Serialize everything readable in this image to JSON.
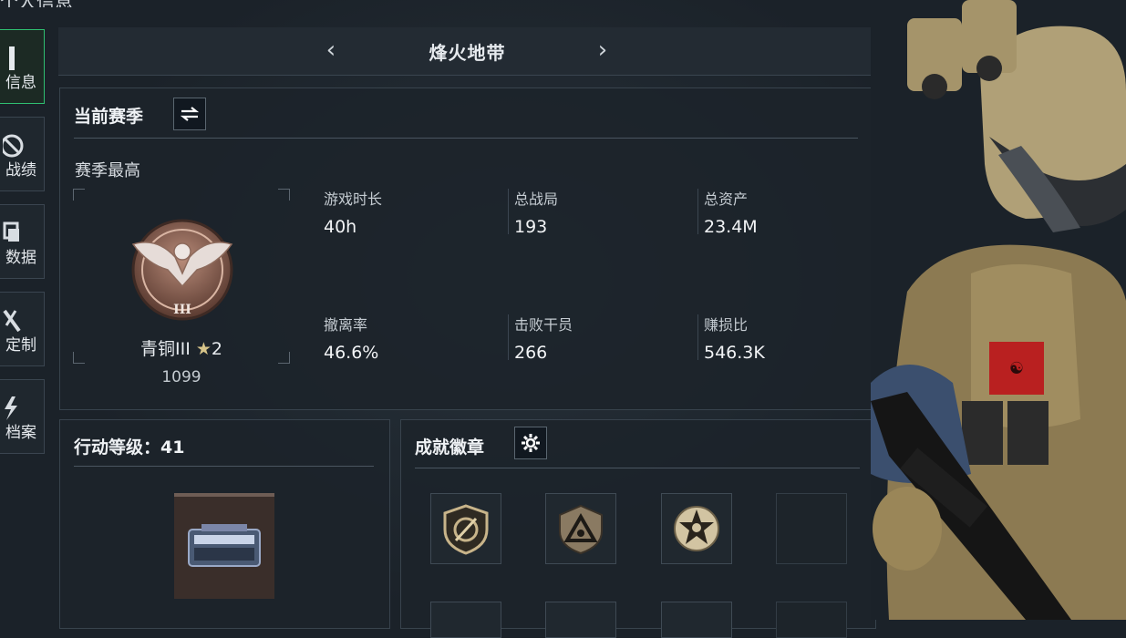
{
  "page": {
    "title": "个人信息"
  },
  "sidebar": {
    "items": [
      {
        "label": "信息",
        "icon": "id-card-icon",
        "active": true
      },
      {
        "label": "战绩",
        "icon": "target-icon",
        "active": false
      },
      {
        "label": "数据",
        "icon": "layers-icon",
        "active": false
      },
      {
        "label": "定制",
        "icon": "wrench-icon",
        "active": false
      },
      {
        "label": "档案",
        "icon": "lightning-icon",
        "active": false
      }
    ]
  },
  "header": {
    "mode_title": "烽火地带",
    "prev_icon": "chevron-left-icon",
    "next_icon": "chevron-right-icon"
  },
  "season": {
    "title": "当前赛季",
    "switch_icon": "swap-icon",
    "subtitle": "赛季最高",
    "rank": {
      "name": "青铜III",
      "stars": "2",
      "score": "1099",
      "emblem_numeral": "III"
    },
    "stats": [
      {
        "label": "游戏时长",
        "value": "40h"
      },
      {
        "label": "总战局",
        "value": "193"
      },
      {
        "label": "总资产",
        "value": "23.4M"
      },
      {
        "label": "撤离率",
        "value": "46.6%"
      },
      {
        "label": "击败干员",
        "value": "266"
      },
      {
        "label": "赚损比",
        "value": "546.3K"
      }
    ]
  },
  "action_level": {
    "title": "行动等级：41"
  },
  "achievements": {
    "title": "成就徽章",
    "settings_icon": "gear-icon",
    "badges": [
      "compass-badge-icon",
      "triangle-badge-icon",
      "skull-star-badge-icon",
      "empty-slot"
    ]
  },
  "colors": {
    "accent": "#2fbf71",
    "background": "#1b2229",
    "bronze": "#a8786a"
  }
}
